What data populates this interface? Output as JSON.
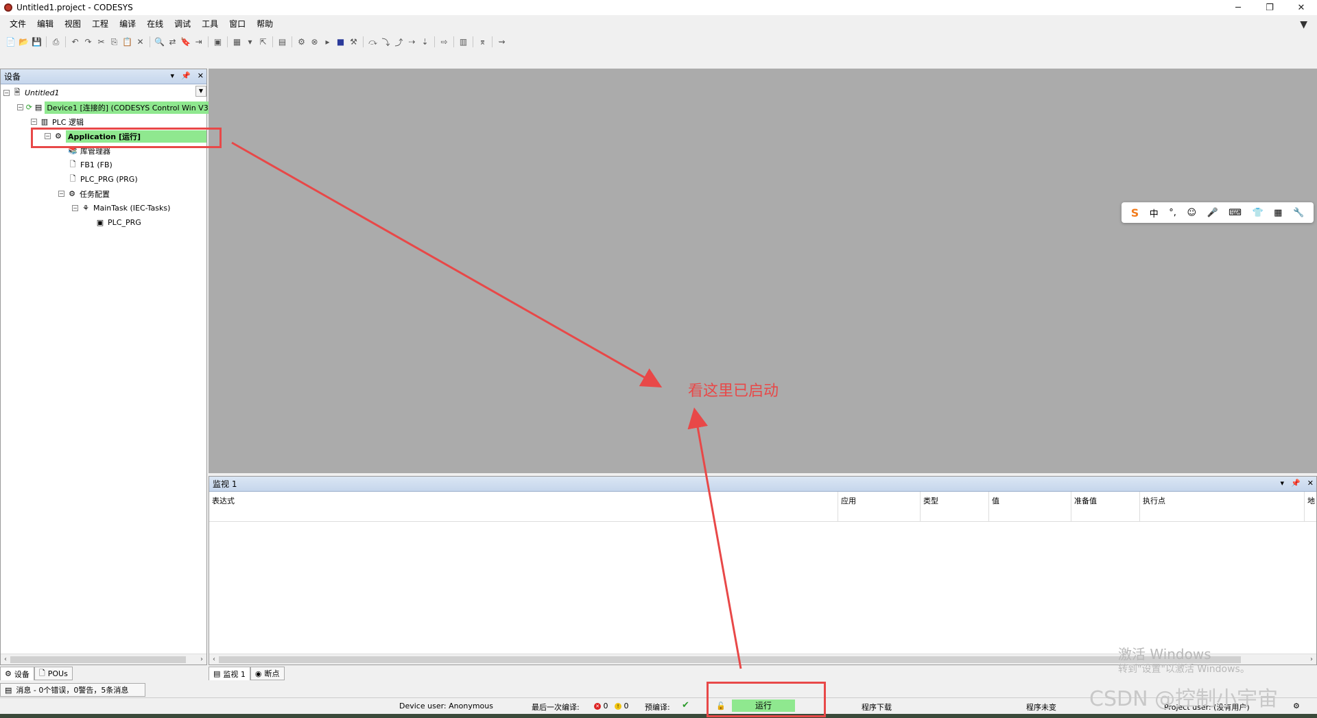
{
  "window": {
    "title": "Untitled1.project - CODESYS",
    "minimize": "─",
    "restore": "❐",
    "close": "✕"
  },
  "menu": [
    "文件",
    "编辑",
    "视图",
    "工程",
    "编译",
    "在线",
    "调试",
    "工具",
    "窗口",
    "帮助"
  ],
  "device_pane": {
    "title": "设备",
    "tree": {
      "project": "Untitled1",
      "device": "Device1 [连接的] (CODESYS Control Win V3)",
      "plc_logic": "PLC 逻辑",
      "application": "Application [运行]",
      "library_manager": "库管理器",
      "fb1": "FB1 (FB)",
      "plc_prg": "PLC_PRG (PRG)",
      "task_config": "任务配置",
      "main_task": "MainTask (IEC-Tasks)",
      "task_plc_prg": "PLC_PRG"
    },
    "tabs": [
      "设备",
      "POUs"
    ]
  },
  "messages": {
    "label": "消息 - 0个错误，0警告，5条消息"
  },
  "ime_bar": {
    "logo": "S",
    "items": [
      "中",
      "°,",
      "☺",
      "🎤",
      "⌨",
      "👕",
      "▦",
      "🔧"
    ]
  },
  "watch_pane": {
    "title": "监视 1",
    "columns": [
      "表达式",
      "应用",
      "类型",
      "值",
      "准备值",
      "执行点",
      "地"
    ],
    "tabs": [
      "监视 1",
      "断点"
    ]
  },
  "statusbar": {
    "device_user": "Device user: Anonymous",
    "last_compile_label": "最后一次编译:",
    "errors": "0",
    "warnings": "0",
    "precompile_label": "预编译:",
    "precompile_ok": "✔",
    "run_state": "运行",
    "download": "程序下载",
    "unchanged": "程序未变",
    "project_user": "Project user: (没有用户)"
  },
  "annotation": {
    "text": "看这里已启动",
    "color": "#e84848"
  },
  "activation": {
    "title": "激活 Windows",
    "subtitle": "转到\"设置\"以激活 Windows。"
  },
  "watermark": "CSDN @控制小宇宙",
  "colors": {
    "running_green": "#8fe88f",
    "editor_gray": "#ababab",
    "annotation_red": "#e84848"
  }
}
